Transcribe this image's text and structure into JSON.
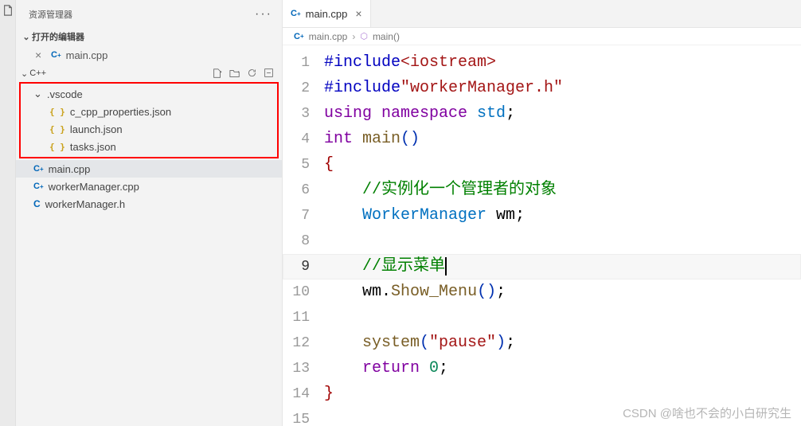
{
  "sidebar": {
    "title": "资源管理器",
    "open_editors_header": "打开的编辑器",
    "open_editors": [
      {
        "name": "main.cpp",
        "icon": "cpp"
      }
    ],
    "project_name": "C++",
    "tree": {
      "folder": ".vscode",
      "files": [
        {
          "name": "c_cpp_properties.json",
          "icon": "json"
        },
        {
          "name": "launch.json",
          "icon": "json"
        },
        {
          "name": "tasks.json",
          "icon": "json"
        }
      ]
    },
    "root_files": [
      {
        "name": "main.cpp",
        "icon": "cpp",
        "active": true
      },
      {
        "name": "workerManager.cpp",
        "icon": "cpp"
      },
      {
        "name": "workerManager.h",
        "icon": "c"
      }
    ]
  },
  "tab": {
    "label": "main.cpp"
  },
  "breadcrumb": {
    "file": "main.cpp",
    "symbol": "main()"
  },
  "code": {
    "lines": [
      {
        "n": 1,
        "seg": [
          [
            "kw-pp",
            "#include"
          ],
          [
            "str",
            "<iostream>"
          ]
        ]
      },
      {
        "n": 2,
        "seg": [
          [
            "kw-pp",
            "#include"
          ],
          [
            "str",
            "\"workerManager.h\""
          ]
        ]
      },
      {
        "n": 3,
        "seg": [
          [
            "kw",
            "using "
          ],
          [
            "kw",
            "namespace "
          ],
          [
            "type",
            "std"
          ],
          [
            "ident",
            ";"
          ]
        ]
      },
      {
        "n": 4,
        "seg": [
          [
            "kw",
            "int "
          ],
          [
            "fn",
            "main"
          ],
          [
            "paren",
            "()"
          ]
        ]
      },
      {
        "n": 5,
        "seg": [
          [
            "brace",
            "{"
          ]
        ]
      },
      {
        "n": 6,
        "seg": [
          [
            "ident",
            "    "
          ],
          [
            "comment",
            "//实例化一个管理者的对象"
          ]
        ]
      },
      {
        "n": 7,
        "seg": [
          [
            "ident",
            "    "
          ],
          [
            "type",
            "WorkerManager "
          ],
          [
            "ident",
            "wm"
          ],
          [
            "ident",
            ";"
          ]
        ]
      },
      {
        "n": 8,
        "seg": []
      },
      {
        "n": 9,
        "seg": [
          [
            "ident",
            "    "
          ],
          [
            "comment",
            "//显示菜单"
          ]
        ],
        "current": true
      },
      {
        "n": 10,
        "seg": [
          [
            "ident",
            "    "
          ],
          [
            "ident",
            "wm"
          ],
          [
            "ident",
            "."
          ],
          [
            "fn",
            "Show_Menu"
          ],
          [
            "paren",
            "()"
          ],
          [
            "ident",
            ";"
          ]
        ]
      },
      {
        "n": 11,
        "seg": []
      },
      {
        "n": 12,
        "seg": [
          [
            "ident",
            "    "
          ],
          [
            "fn",
            "system"
          ],
          [
            "paren",
            "("
          ],
          [
            "str",
            "\"pause\""
          ],
          [
            "paren",
            ")"
          ],
          [
            "ident",
            ";"
          ]
        ]
      },
      {
        "n": 13,
        "seg": [
          [
            "ident",
            "    "
          ],
          [
            "kw",
            "return "
          ],
          [
            "num",
            "0"
          ],
          [
            "ident",
            ";"
          ]
        ]
      },
      {
        "n": 14,
        "seg": [
          [
            "brace",
            "}"
          ]
        ]
      },
      {
        "n": 15,
        "seg": []
      }
    ]
  },
  "watermark": "CSDN @啥也不会的小白研究生"
}
